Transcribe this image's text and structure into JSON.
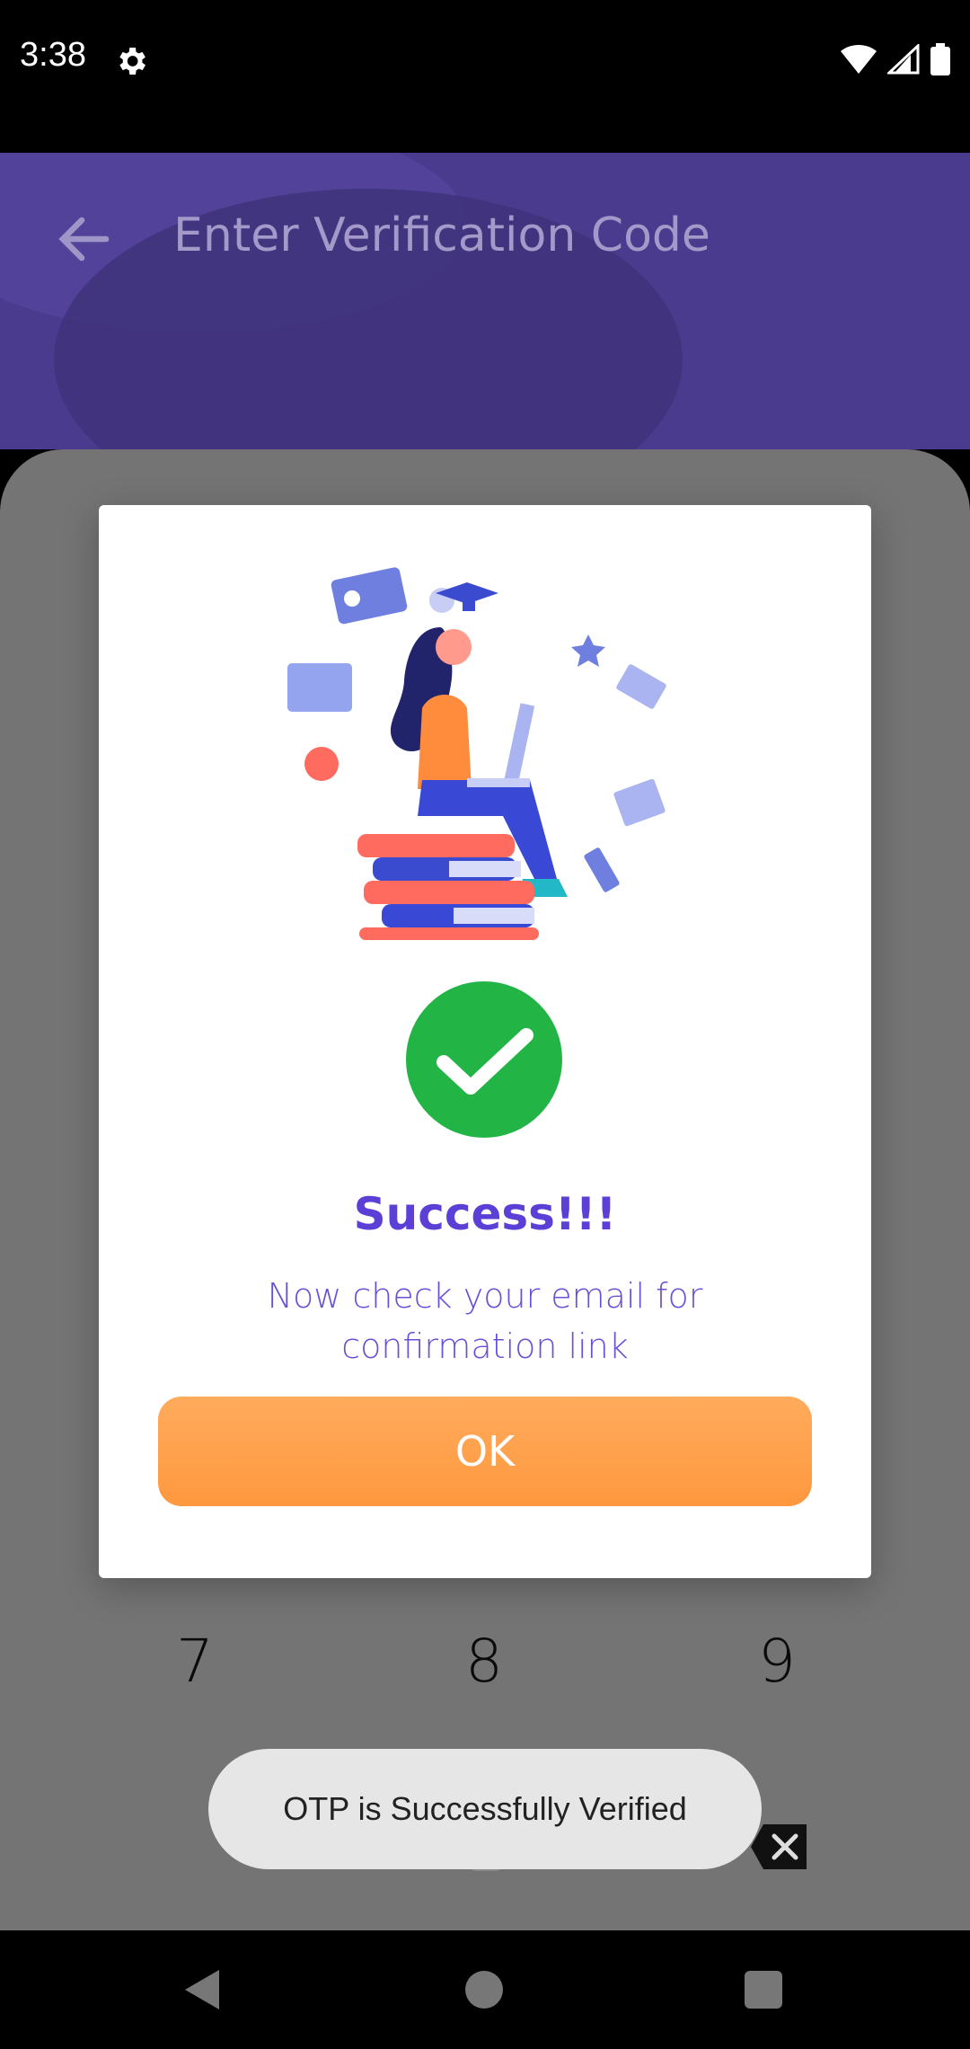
{
  "status_bar": {
    "time": "3:38",
    "icons": [
      "gear-icon",
      "wifi-icon",
      "signal-icon",
      "battery-icon"
    ]
  },
  "header": {
    "title": "Enter Verification Code",
    "back_icon": "arrow-left-icon"
  },
  "keypad": {
    "visible_keys": [
      "7",
      "8",
      "9"
    ],
    "backspace_icon": "backspace-icon"
  },
  "dialog": {
    "illustration": "student-with-laptop-illustration",
    "check_icon": "check-circle-icon",
    "title": "Success!!!",
    "message": "Now check your email for confirmation link",
    "ok_label": "OK"
  },
  "toast": {
    "message": "OTP is Successfully Verified"
  },
  "colors": {
    "accent": "#5b3fd6",
    "button": "#ff9f48",
    "success": "#22b545",
    "header": "#4a3b8f"
  },
  "nav_bar": {
    "icons": [
      "nav-back-icon",
      "nav-home-icon",
      "nav-recent-icon"
    ]
  }
}
